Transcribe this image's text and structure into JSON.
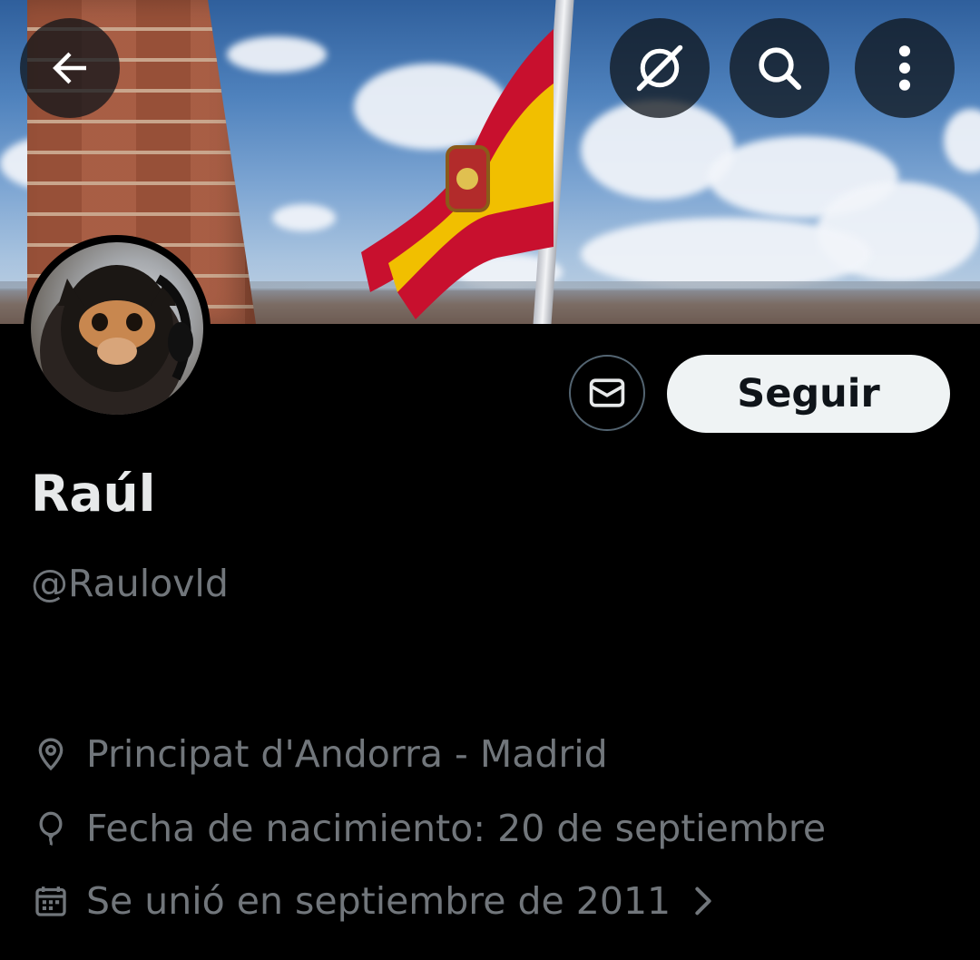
{
  "header": {
    "back_icon": "arrow-left-icon",
    "grok_icon": "grok-icon",
    "search_icon": "search-icon",
    "more_icon": "more-vertical-icon"
  },
  "profile": {
    "display_name": "Raúl",
    "handle": "@Raulovld",
    "follow_label": "Seguir",
    "message_icon": "envelope-icon",
    "location": "Principat d'Andorra - Madrid",
    "birthday": "Fecha de nacimiento: 20 de septiembre",
    "joined": "Se unió en septiembre de 2011"
  },
  "colors": {
    "background": "#000000",
    "primary_text": "#e7e9ea",
    "secondary_text": "#71767b",
    "follow_button_bg": "#eff3f4",
    "border": "#536471"
  }
}
